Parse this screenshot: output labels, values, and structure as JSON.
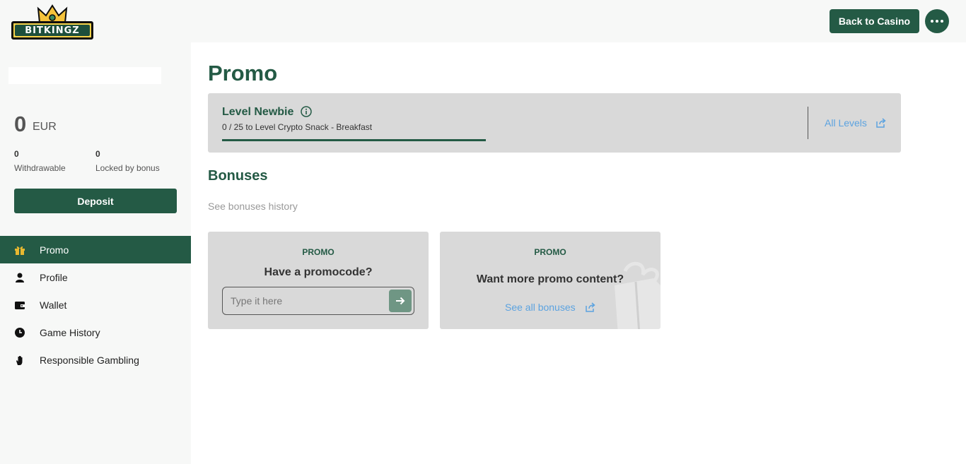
{
  "header": {
    "logo_text": "BITKINGZ",
    "back_button": "Back to Casino"
  },
  "sidebar": {
    "balance": {
      "amount": "0",
      "currency": "EUR"
    },
    "withdrawable": {
      "value": "0",
      "label": "Withdrawable"
    },
    "locked": {
      "value": "0",
      "label": "Locked by bonus"
    },
    "deposit_button": "Deposit",
    "nav": [
      {
        "label": "Promo",
        "icon": "gift-icon",
        "active": true
      },
      {
        "label": "Profile",
        "icon": "user-icon",
        "active": false
      },
      {
        "label": "Wallet",
        "icon": "wallet-icon",
        "active": false
      },
      {
        "label": "Game History",
        "icon": "clock-icon",
        "active": false
      },
      {
        "label": "Responsible Gambling",
        "icon": "hand-icon",
        "active": false
      }
    ]
  },
  "main": {
    "title": "Promo",
    "level": {
      "title": "Level Newbie",
      "progress_text": "0 / 25 to Level Crypto Snack - Breakfast",
      "progress": 0,
      "all_levels_link": "All Levels"
    },
    "bonuses": {
      "title": "Bonuses",
      "history_link": "See bonuses history"
    },
    "promo_cards": [
      {
        "tag": "PROMO",
        "heading": "Have a promocode?",
        "input_placeholder": "Type it here"
      },
      {
        "tag": "PROMO",
        "heading": "Want more promo content?",
        "link": "See all bonuses"
      }
    ]
  },
  "colors": {
    "brand_green": "#245a45",
    "link_blue": "#5ca3e0",
    "card_gray": "#d9d9d9",
    "sidebar_bg": "#f7f8f7"
  }
}
